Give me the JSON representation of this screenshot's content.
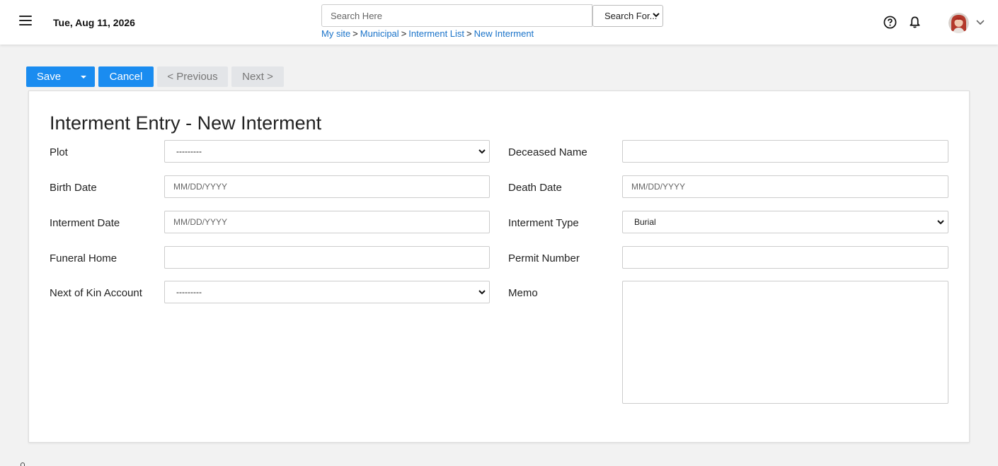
{
  "header": {
    "date": "Tue, Aug 11, 2026",
    "search_placeholder": "Search Here",
    "search_for_label": "Search For...",
    "breadcrumb": [
      "My site",
      "Municipal",
      "Interment List",
      "New Interment"
    ],
    "breadcrumb_separator": ">",
    "icons": [
      "menu-icon",
      "help-icon",
      "bell-icon",
      "avatar",
      "chevron-down-icon"
    ]
  },
  "toolbar": {
    "save_label": "Save",
    "cancel_label": "Cancel",
    "previous_label": "< Previous",
    "next_label": "Next >",
    "accent_color": "#1a8cf0"
  },
  "form": {
    "title": "Interment Entry - New Interment",
    "plot": {
      "label": "Plot",
      "value": "---------"
    },
    "deceased_name": {
      "label": "Deceased Name",
      "value": ""
    },
    "birth_date": {
      "label": "Birth Date",
      "placeholder": "MM/DD/YYYY"
    },
    "death_date": {
      "label": "Death Date",
      "placeholder": "MM/DD/YYYY"
    },
    "interment_date": {
      "label": "Interment Date",
      "placeholder": "MM/DD/YYYY"
    },
    "interment_type": {
      "label": "Interment Type",
      "value": "Burial"
    },
    "funeral_home": {
      "label": "Funeral Home",
      "value": ""
    },
    "permit_number": {
      "label": "Permit Number",
      "value": ""
    },
    "next_of_kin": {
      "label": "Next of Kin Account",
      "value": "---------"
    },
    "memo": {
      "label": "Memo",
      "value": ""
    }
  }
}
